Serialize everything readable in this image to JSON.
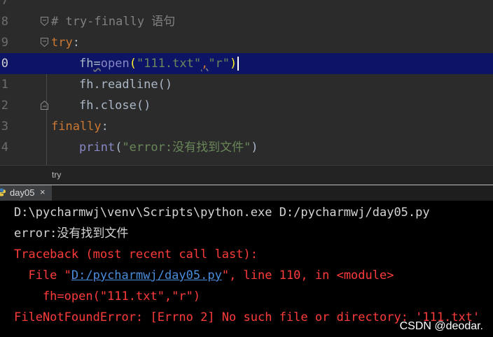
{
  "editor": {
    "lines": [
      {
        "num": "7",
        "text": ""
      },
      {
        "num": "8",
        "comment": "# try-finally 语句"
      },
      {
        "num": "9",
        "kw": "try",
        "punct": ":"
      },
      {
        "num": "0",
        "var": "fh",
        "eq": "=",
        "fn": "open",
        "open_paren": "(",
        "arg1": "\"111.txt\"",
        "comma": ",",
        "arg2": "\"r\"",
        "close_paren": ")"
      },
      {
        "num": "1",
        "text": "fh.readline()"
      },
      {
        "num": "2",
        "text": "fh.close()"
      },
      {
        "num": "3",
        "kw": "finally",
        "punct": ":"
      },
      {
        "num": "4",
        "fn": "print",
        "open_paren": "(",
        "arg": "\"error:没有找到文件\"",
        "close_paren": ")"
      }
    ]
  },
  "breadcrumb": "try",
  "run_tab": {
    "label": "day05",
    "close": "×"
  },
  "console": {
    "cmd": "D:\\pycharmwj\\venv\\Scripts\\python.exe D:/pycharmwj/day05.py",
    "out": "error:没有找到文件",
    "traceback": "Traceback (most recent call last):",
    "file_prefix": "  File \"",
    "file_link": "D:/pycharmwj/day05.py",
    "file_suffix": "\", line 110, in <module>",
    "code": "    fh=open(\"111.txt\",\"r\")",
    "error": "FileNotFoundError: [Errno 2] No such file or directory: '111.txt'"
  },
  "watermark": "CSDN @deodar."
}
